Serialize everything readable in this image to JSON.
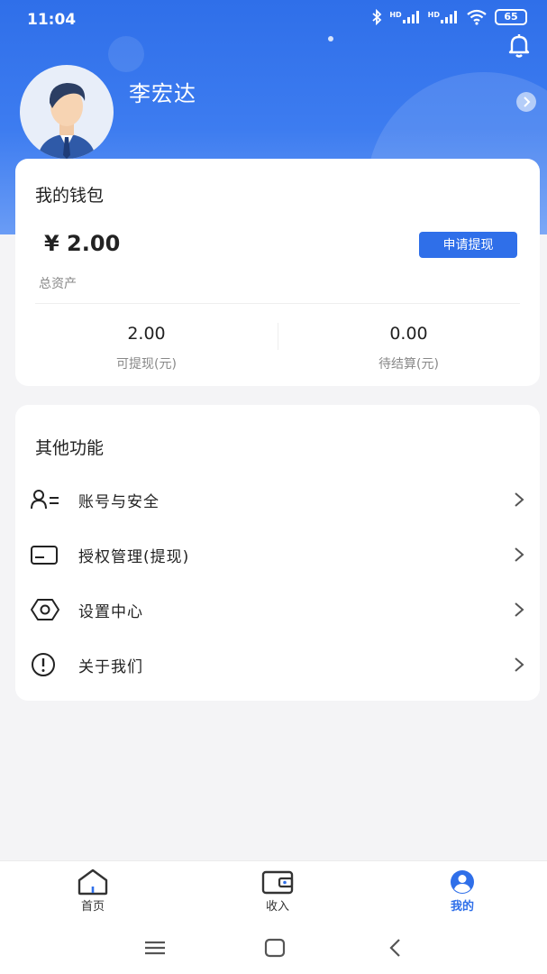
{
  "status_bar": {
    "time": "11:04",
    "signal1": "HD",
    "signal2": "HD",
    "battery": "65"
  },
  "profile": {
    "name": "李宏达"
  },
  "wallet": {
    "title": "我的钱包",
    "balance": "¥ 2.00",
    "balance_label": "总资产",
    "withdraw_button": "申请提现",
    "withdrawable_value": "2.00",
    "withdrawable_label": "可提现(元)",
    "pending_value": "0.00",
    "pending_label": "待结算(元)"
  },
  "features": {
    "title": "其他功能",
    "items": [
      {
        "label": "账号与安全",
        "icon": "user-list-icon"
      },
      {
        "label": "授权管理(提现)",
        "icon": "card-icon"
      },
      {
        "label": "设置中心",
        "icon": "settings-hex-icon"
      },
      {
        "label": "关于我们",
        "icon": "info-icon"
      }
    ]
  },
  "tabbar": {
    "tabs": [
      {
        "label": "首页",
        "icon": "home-icon"
      },
      {
        "label": "收入",
        "icon": "wallet-icon"
      },
      {
        "label": "我的",
        "icon": "profile-icon",
        "active": true
      }
    ]
  },
  "colors": {
    "accent": "#2f6fe9",
    "background": "#f4f4f6"
  }
}
